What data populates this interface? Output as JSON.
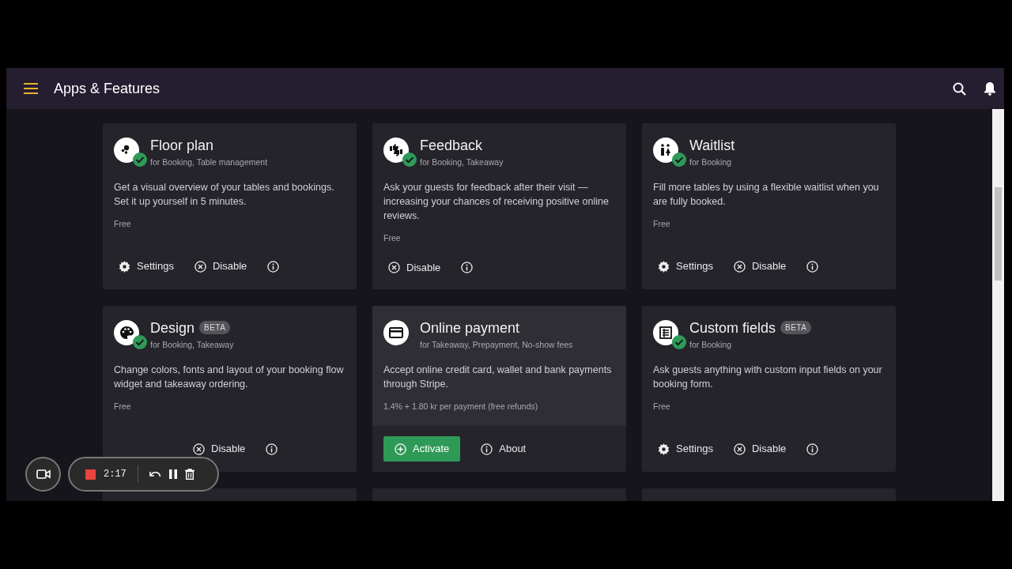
{
  "app_bar": {
    "title": "Apps & Features"
  },
  "apps": [
    {
      "kind": "app",
      "title": "Floor plan",
      "for": "for Booking, Table management",
      "description": "Get a visual overview of your tables and bookings. Set it up yourself in 5 minutes.",
      "price": "Free",
      "enabled": true,
      "hovered": false,
      "actions": [
        {
          "kind": "settings",
          "label": "Settings"
        },
        {
          "kind": "disable",
          "label": "Disable"
        },
        {
          "kind": "info"
        }
      ]
    },
    {
      "kind": "app",
      "title": "Feedback",
      "for": "for Booking, Takeaway",
      "description": "Ask your guests for feedback after their visit — increasing your chances of receiving positive online reviews.",
      "price": "Free",
      "enabled": true,
      "hovered": false,
      "actions": [
        {
          "kind": "disable",
          "label": "Disable"
        },
        {
          "kind": "info"
        }
      ]
    },
    {
      "kind": "app",
      "title": "Waitlist",
      "for": "for Booking",
      "description": "Fill more tables by using a flexible waitlist when you are fully booked.",
      "price": "Free",
      "enabled": true,
      "hovered": false,
      "actions": [
        {
          "kind": "settings",
          "label": "Settings"
        },
        {
          "kind": "disable",
          "label": "Disable"
        },
        {
          "kind": "info"
        }
      ]
    },
    {
      "kind": "app",
      "title": "Design",
      "badge": "BETA",
      "for": "for Booking, Takeaway",
      "description": "Change colors, fonts and layout of your booking flow widget and takeaway ordering.",
      "price": "Free",
      "enabled": true,
      "hovered": false,
      "actions": [
        {
          "kind": "disable",
          "label": "Disable",
          "offset": true
        },
        {
          "kind": "info"
        }
      ]
    },
    {
      "kind": "app",
      "title": "Online payment",
      "for": "for Takeaway, Prepayment, No-show fees",
      "description": "Accept online credit card, wallet and bank payments through Stripe.",
      "price": "1.4% + 1.80 kr per payment (free refunds)",
      "enabled": false,
      "hovered": true,
      "actions": [
        {
          "kind": "activate",
          "label": "Activate"
        },
        {
          "kind": "about",
          "label": "About"
        }
      ]
    },
    {
      "kind": "app",
      "title": "Custom fields",
      "badge": "BETA",
      "for": "for Booking",
      "description": "Ask guests anything with custom input fields on your booking form.",
      "price": "Free",
      "enabled": true,
      "hovered": false,
      "actions": [
        {
          "kind": "settings",
          "label": "Settings"
        },
        {
          "kind": "disable",
          "label": "Disable"
        },
        {
          "kind": "info"
        }
      ]
    },
    {
      "kind": "cut_off"
    },
    {
      "kind": "cut_off"
    },
    {
      "kind": "cut_off"
    }
  ],
  "recorder": {
    "time": "2:17"
  }
}
